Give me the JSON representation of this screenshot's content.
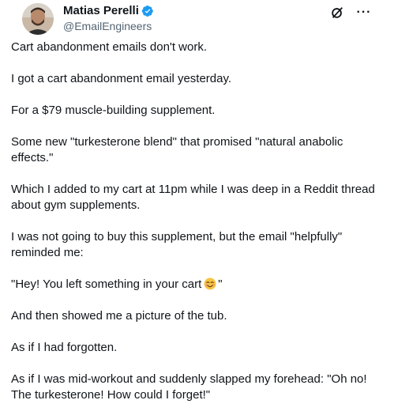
{
  "author": {
    "display_name": "Matias Perelli",
    "handle": "@EmailEngineers",
    "verified_icon": "verified-badge-icon",
    "avatar": "profile-photo"
  },
  "header_actions": {
    "grok_icon": "grok-slash-circle-icon",
    "more_icon": "more-horizontal-icon",
    "more_label": "···"
  },
  "tweet": {
    "paragraphs": [
      "Cart abandonment emails don't work.",
      "I got a cart abandonment email yesterday.",
      "For a $79 muscle-building supplement.",
      "Some new \"turkesterone blend\" that promised \"natural anabolic effects.\"",
      "Which I added to my cart at 11pm while I was deep in a Reddit thread about gym supplements.",
      "I was not going to buy this supplement, but the email \"helpfully\" reminded me:",
      "\"Hey! You left something in your cart",
      "And then showed me a picture of the tub.",
      "As if I had forgotten.",
      "As if I was mid-workout and suddenly slapped my forehead: \"Oh no! The turkesterone! How could I forget!\""
    ],
    "quote_close": "\"",
    "emoji": "smiling-face-emoji"
  },
  "colors": {
    "text": "#0f1419",
    "secondary": "#536471",
    "verified": "#1d9bf0"
  }
}
